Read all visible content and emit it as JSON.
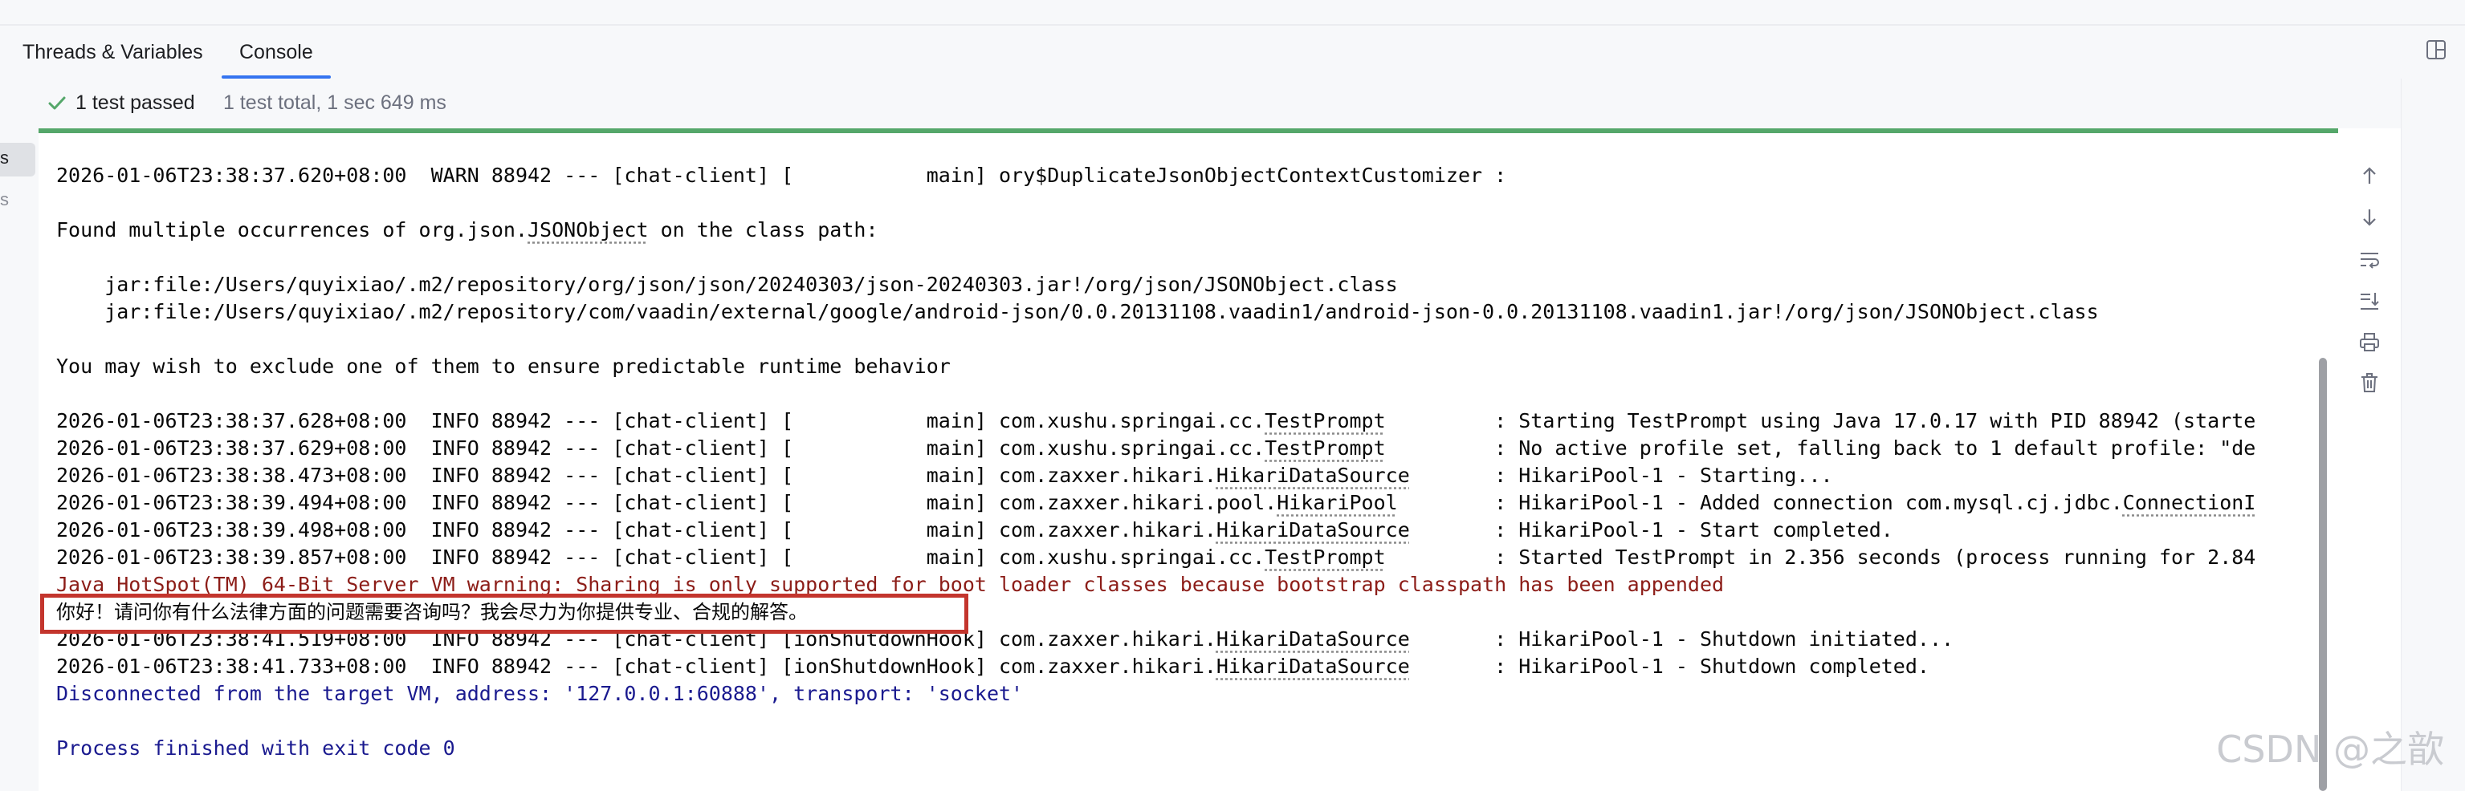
{
  "tabs": [
    {
      "label": "Threads & Variables",
      "active": false
    },
    {
      "label": "Console",
      "active": true
    }
  ],
  "left_panel": {
    "label_1": "s",
    "label_2": "s"
  },
  "status": {
    "passed": "1 test passed",
    "total": "1 test total, 1 sec 649 ms",
    "color": "#55a76a"
  },
  "console": {
    "lines": [
      {
        "parts": [
          "2026-01-06T23:38:37.620+08:00  WARN 88942 --- [chat-client] [           main] ory$DuplicateJsonObjectContextCustomizer :"
        ]
      },
      {
        "parts": [
          "Found multiple occurrences of org.json.",
          "JSONObject",
          " on the class path:"
        ]
      },
      {
        "parts": [
          "    jar:file:/Users/quyixiao/.m2/repository/org/json/json/20240303/json-20240303.jar!/org/json/JSONObject.class"
        ]
      },
      {
        "parts": [
          "    jar:file:/Users/quyixiao/.m2/repository/com/vaadin/external/google/android-json/0.0.20131108.vaadin1/android-json-0.0.20131108.vaadin1.jar!/org/json/JSONObject.class"
        ]
      },
      {
        "parts": [
          "You may wish to exclude one of them to ensure predictable runtime behavior"
        ]
      },
      {
        "parts": [
          "2026-01-06T23:38:37.628+08:00  INFO 88942 --- [chat-client] [           main] com.xushu.springai.cc.",
          "TestPrompt",
          "         : Starting TestPrompt using Java 17.0.17 with PID 88942 (starte"
        ]
      },
      {
        "parts": [
          "2026-01-06T23:38:37.629+08:00  INFO 88942 --- [chat-client] [           main] com.xushu.springai.cc.",
          "TestPrompt",
          "         : No active profile set, falling back to 1 default profile: \"de"
        ]
      },
      {
        "parts": [
          "2026-01-06T23:38:38.473+08:00  INFO 88942 --- [chat-client] [           main] com.zaxxer.hikari.",
          "HikariDataSource",
          "       : HikariPool-1 - Starting..."
        ]
      },
      {
        "parts": [
          "2026-01-06T23:38:39.494+08:00  INFO 88942 --- [chat-client] [           main] com.zaxxer.hikari.pool.",
          "HikariPool",
          "        : HikariPool-1 - Added connection com.mysql.cj.jdbc.",
          "ConnectionI"
        ]
      },
      {
        "parts": [
          "2026-01-06T23:38:39.498+08:00  INFO 88942 --- [chat-client] [           main] com.zaxxer.hikari.",
          "HikariDataSource",
          "       : HikariPool-1 - Start completed."
        ]
      },
      {
        "parts": [
          "2026-01-06T23:38:39.857+08:00  INFO 88942 --- [chat-client] [           main] com.xushu.springai.cc.",
          "TestPrompt",
          "         : Started TestPrompt in 2.356 seconds (process running for 2.84"
        ]
      },
      {
        "parts": [
          "Java HotSpot(TM) 64-Bit Server VM warning: Sharing is only supported for boot loader classes because bootstrap classpath has been appended"
        ]
      },
      {
        "parts": [
          "你好！请问你有什么法律方面的问题需要咨询吗？我会尽力为你提供专业、合规的解答。"
        ]
      },
      {
        "parts": [
          "2026-01-06T23:38:41.519+08:00  INFO 88942 --- [chat-client] [ionShutdownHook] com.zaxxer.hikari.",
          "HikariDataSource",
          "       : HikariPool-1 - Shutdown initiated..."
        ]
      },
      {
        "parts": [
          "2026-01-06T23:38:41.733+08:00  INFO 88942 --- [chat-client] [ionShutdownHook] com.zaxxer.hikari.",
          "HikariDataSource",
          "       : HikariPool-1 - Shutdown completed."
        ]
      },
      {
        "parts": [
          "Disconnected from the target VM, address: '127.0.0.1:60888', transport: 'socket'"
        ]
      },
      {
        "parts": [
          "Process finished with exit code 0"
        ]
      }
    ],
    "highlight_color": "#c3352d"
  },
  "watermark": "CSDN @之歆",
  "right_toolbar": [
    "up-arrow-icon",
    "down-arrow-icon",
    "soft-wrap-icon",
    "scroll-to-end-icon",
    "print-icon",
    "trash-icon"
  ]
}
